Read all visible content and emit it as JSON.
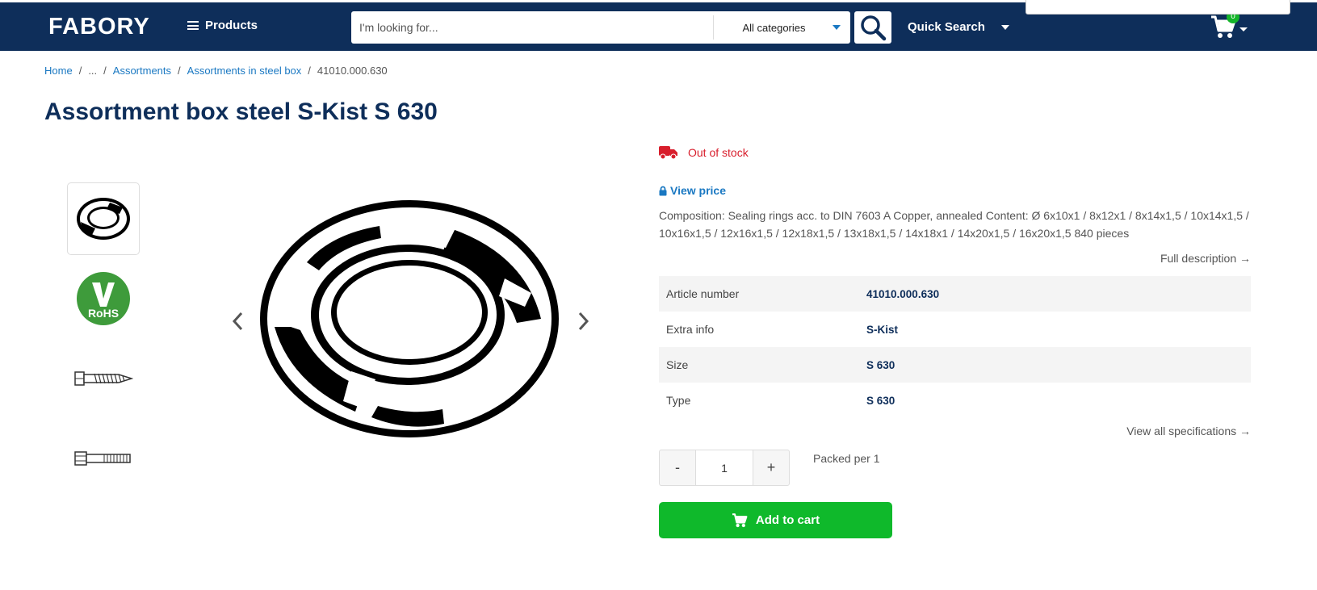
{
  "header": {
    "logo": "FABORY",
    "products_label": "Products",
    "search": {
      "placeholder": "I'm looking for...",
      "value": "",
      "category": "All categories"
    },
    "quick_search_label": "Quick Search",
    "cart_count": "0"
  },
  "breadcrumb": {
    "home": "Home",
    "ellipsis": "...",
    "assortments": "Assortments",
    "assortments_steel": "Assortments in steel box",
    "current": "41010.000.630",
    "separator": "/"
  },
  "product": {
    "title": "Assortment box steel S-Kist S 630",
    "stock_status": "Out of stock",
    "view_price": "View price",
    "composition": "Composition: Sealing rings acc. to DIN 7603 A Copper, annealed Content: Ø 6x10x1 / 8x12x1 / 8x14x1,5 / 10x14x1,5 / 10x16x1,5 / 12x16x1,5 / 12x18x1,5 / 13x18x1,5 / 14x18x1 / 14x20x1,5 / 16x20x1,5 840 pieces",
    "full_description": "Full description →",
    "specs": [
      {
        "label": "Article number",
        "value": "41010.000.630"
      },
      {
        "label": "Extra info",
        "value": "S-Kist"
      },
      {
        "label": "Size",
        "value": "S 630"
      },
      {
        "label": "Type",
        "value": "S 630"
      }
    ],
    "view_all_specs": "View all specifications →",
    "quantity": {
      "minus": "-",
      "value": "1",
      "plus": "+"
    },
    "packed": "Packed per 1",
    "add_to_cart": "Add to cart",
    "rohs_text": "RoHS"
  },
  "colors": {
    "header_bg": "#0e2e5a",
    "link": "#1a78c2",
    "out_of_stock": "#d81e2c",
    "add_to_cart": "#0fb92b"
  }
}
